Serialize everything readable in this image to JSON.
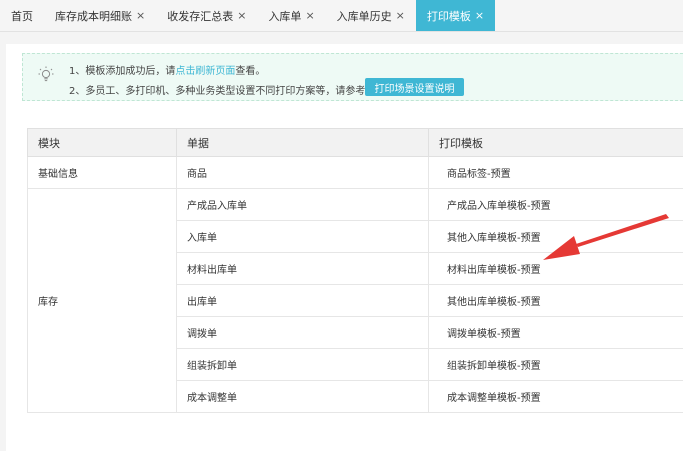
{
  "tabs": [
    {
      "label": "首页",
      "closable": false,
      "active": false
    },
    {
      "label": "库存成本明细账",
      "closable": true,
      "active": false
    },
    {
      "label": "收发存汇总表",
      "closable": true,
      "active": false
    },
    {
      "label": "入库单",
      "closable": true,
      "active": false
    },
    {
      "label": "入库单历史",
      "closable": true,
      "active": false
    },
    {
      "label": "打印模板",
      "closable": true,
      "active": true
    }
  ],
  "close_glyph": "×",
  "notice": {
    "line1_prefix": "1、模板添加成功后，请",
    "line1_link": "点击刷新页面",
    "line1_suffix": "查看。",
    "line2": "2、多员工、多打印机、多种业务类型设置不同打印方案等，请参考",
    "button": "打印场景设置说明"
  },
  "table": {
    "headers": [
      "模块",
      "单据",
      "打印模板"
    ],
    "groups": [
      {
        "module": "基础信息",
        "rows": [
          {
            "doc": "商品",
            "template": "商品标签-预置"
          }
        ]
      },
      {
        "module": "库存",
        "rows": [
          {
            "doc": "产成品入库单",
            "template": "产成品入库单模板-预置"
          },
          {
            "doc": "入库单",
            "template": "其他入库单模板-预置"
          },
          {
            "doc": "材料出库单",
            "template": "材料出库单模板-预置"
          },
          {
            "doc": "出库单",
            "template": "其他出库单模板-预置"
          },
          {
            "doc": "调拨单",
            "template": "调拨单模板-预置"
          },
          {
            "doc": "组装拆卸单",
            "template": "组装拆卸单模板-预置"
          },
          {
            "doc": "成本调整单",
            "template": "成本调整单模板-预置"
          }
        ]
      }
    ]
  },
  "colors": {
    "accent": "#3fb7d4",
    "arrow": "#e53935"
  }
}
